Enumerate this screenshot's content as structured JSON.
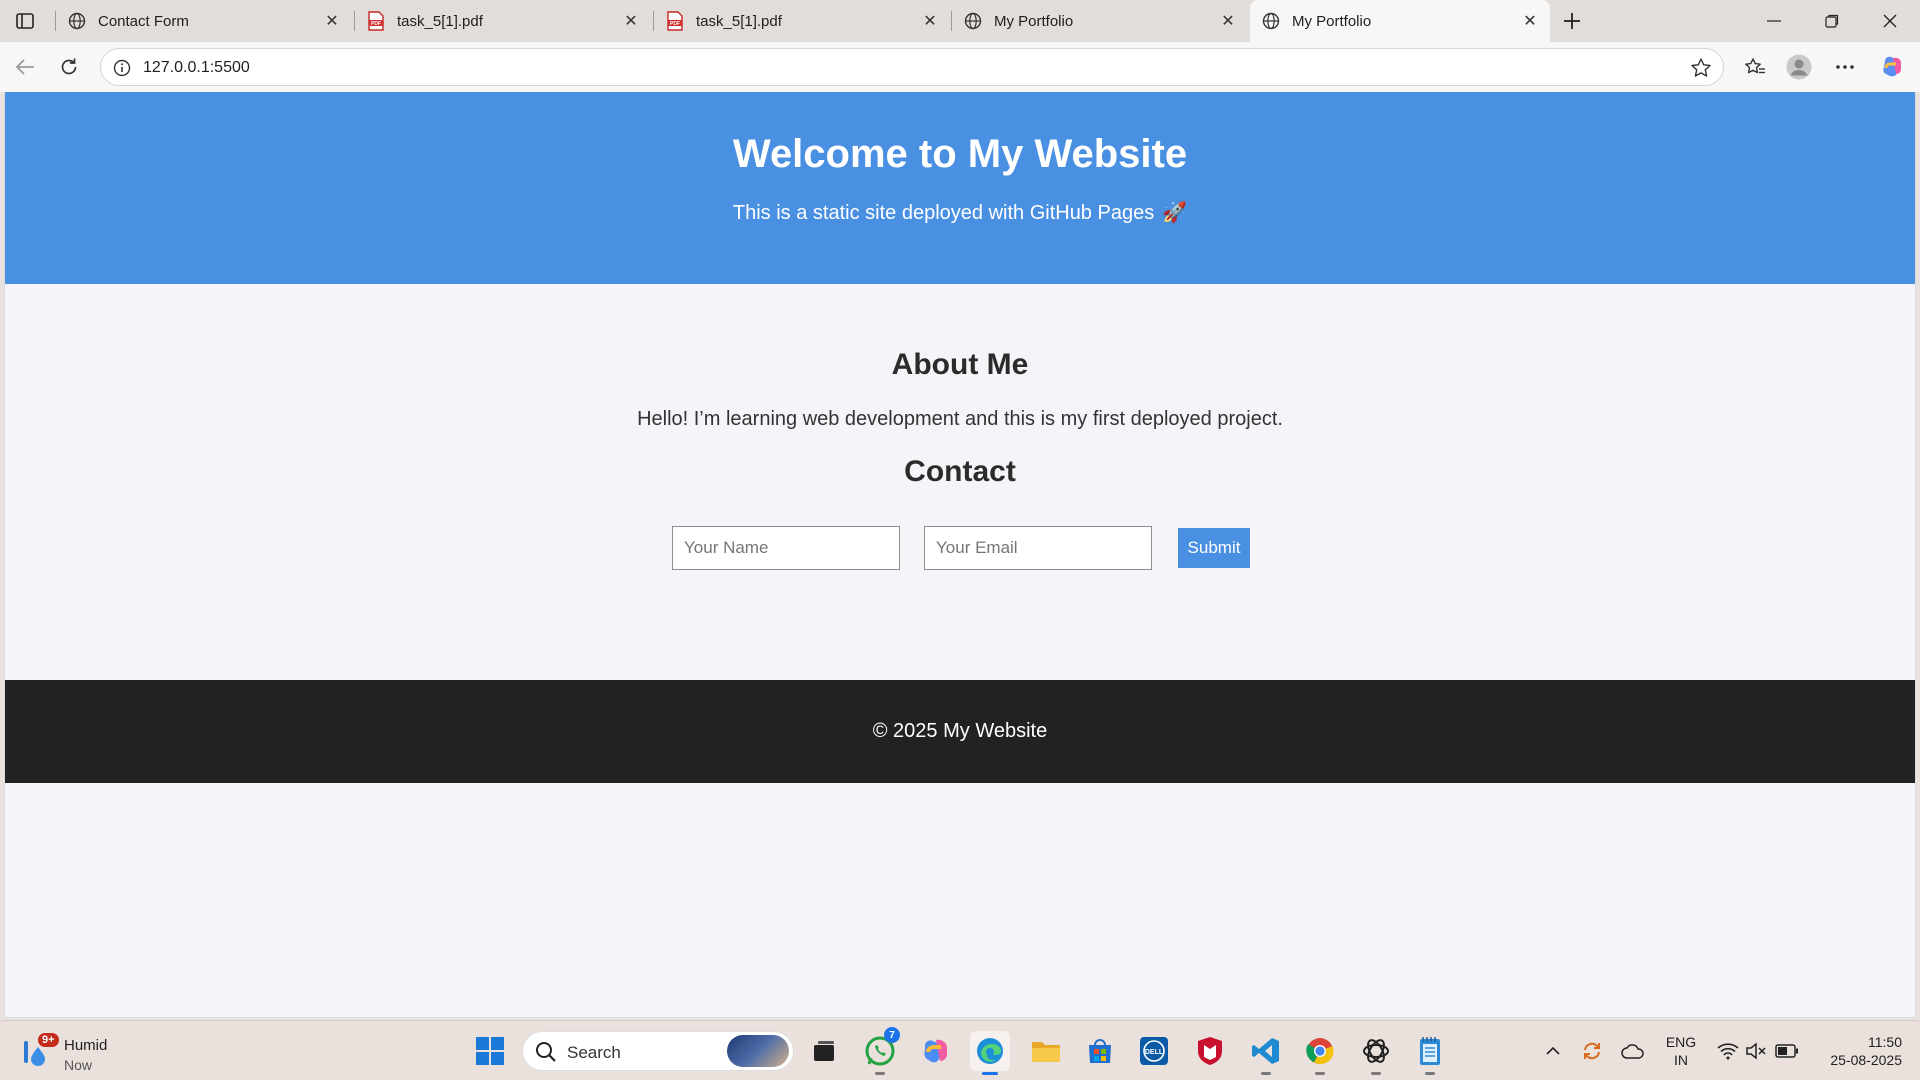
{
  "browser": {
    "tabs": [
      {
        "title": "Contact Form",
        "icon": "globe-icon"
      },
      {
        "title": "task_5[1].pdf",
        "icon": "pdf-icon"
      },
      {
        "title": "task_5[1].pdf",
        "icon": "pdf-icon"
      },
      {
        "title": "My Portfolio",
        "icon": "globe-icon"
      },
      {
        "title": "My Portfolio",
        "icon": "globe-icon",
        "active": true
      }
    ],
    "url": "127.0.0.1:5500"
  },
  "page": {
    "header_title": "Welcome to My Website",
    "header_subtitle": "This is a static site deployed with GitHub Pages",
    "header_emoji": "🚀",
    "about_title": "About Me",
    "about_text": "Hello! I’m learning web development and this is my first deployed project.",
    "contact_title": "Contact",
    "name_placeholder": "Your Name",
    "email_placeholder": "Your Email",
    "submit_label": "Submit",
    "footer_text": "© 2025 My Website",
    "colors": {
      "header": "#4a90e2",
      "footer": "#222222",
      "background": "#f4f4f9",
      "button": "#4a90e2"
    }
  },
  "taskbar": {
    "weather_title": "Humid",
    "weather_sub": "Now",
    "weather_badge": "9+",
    "search_placeholder": "Search",
    "whatsapp_badge": "7",
    "lang_line1": "ENG",
    "lang_line2": "IN",
    "time": "11:50",
    "date": "25-08-2025"
  }
}
